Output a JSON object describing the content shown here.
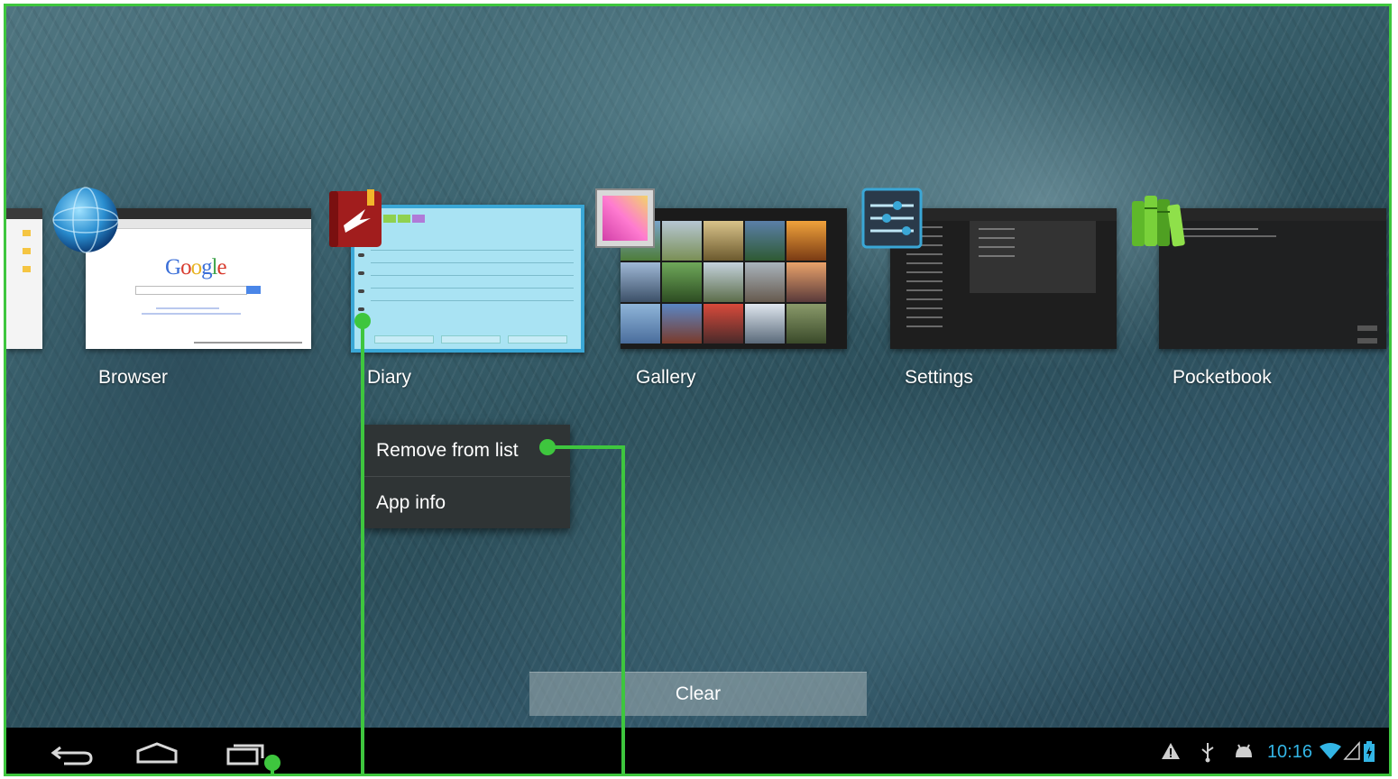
{
  "recents": {
    "apps": [
      {
        "label": "Browser",
        "icon": "browser-globe-icon"
      },
      {
        "label": "Diary",
        "icon": "diary-book-icon"
      },
      {
        "label": "Gallery",
        "icon": "gallery-icon"
      },
      {
        "label": "Settings",
        "icon": "settings-sliders-icon"
      },
      {
        "label": "Pocketbook",
        "icon": "pocketbook-books-icon"
      }
    ],
    "browser_preview": {
      "logo": "Google"
    }
  },
  "context_menu": {
    "items": [
      "Remove from list",
      "App info"
    ]
  },
  "clear_button": {
    "label": "Clear"
  },
  "system_bar": {
    "nav": [
      "back-icon",
      "home-icon",
      "recent-apps-icon"
    ],
    "status_icons": [
      "warning-icon",
      "usb-icon",
      "android-debug-icon",
      "wifi-icon",
      "signal-icon",
      "battery-charging-icon"
    ],
    "time": "10:16"
  },
  "colors": {
    "accent": "#33b5e5",
    "selection_border": "#3aa7d6",
    "annotation": "#3ec63e",
    "menu_bg": "#2f3435",
    "systembar_bg": "#000000"
  }
}
